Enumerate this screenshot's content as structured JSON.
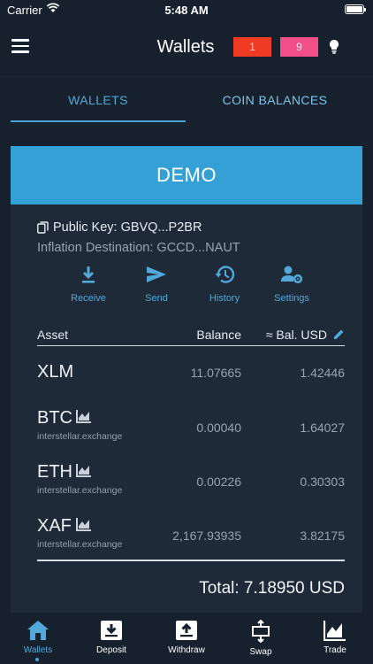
{
  "status_bar": {
    "carrier": "Carrier",
    "time": "5:48 AM"
  },
  "nav": {
    "title": "Wallets",
    "badge_red": "1",
    "badge_pink": "9",
    "colors": {
      "badge_red": "#ef3b24",
      "badge_pink": "#f24f88"
    }
  },
  "tabs": [
    {
      "label": "WALLETS",
      "active": true
    },
    {
      "label": "COIN BALANCES",
      "active": false
    }
  ],
  "wallet": {
    "name": "DEMO",
    "public_key": "Public Key: GBVQ...P2BR",
    "inflation": "Inflation Destination: GCCD...NAUT",
    "actions": [
      {
        "label": "Receive",
        "icon": "download-icon"
      },
      {
        "label": "Send",
        "icon": "send-icon"
      },
      {
        "label": "History",
        "icon": "history-icon"
      },
      {
        "label": "Settings",
        "icon": "user-settings-icon"
      }
    ],
    "table": {
      "headers": {
        "asset": "Asset",
        "balance": "Balance",
        "usd": "≈ Bal. USD"
      },
      "rows": [
        {
          "asset": "XLM",
          "domain": "",
          "balance": "11.07665",
          "usd": "1.42446"
        },
        {
          "asset": "BTC",
          "domain": "interstellar.exchange",
          "balance": "0.00040",
          "usd": "1.64027"
        },
        {
          "asset": "ETH",
          "domain": "interstellar.exchange",
          "balance": "0.00226",
          "usd": "0.30303"
        },
        {
          "asset": "XAF",
          "domain": "interstellar.exchange",
          "balance": "2,167.93935",
          "usd": "3.82175"
        }
      ]
    },
    "total": "Total: 7.18950 USD",
    "accent": "#35a0d6"
  },
  "tabbar": [
    {
      "label": "Wallets",
      "icon": "home-icon",
      "active": true
    },
    {
      "label": "Deposit",
      "icon": "deposit-icon",
      "active": false
    },
    {
      "label": "Withdraw",
      "icon": "withdraw-icon",
      "active": false
    },
    {
      "label": "Swap",
      "icon": "swap-icon",
      "active": false
    },
    {
      "label": "Trade",
      "icon": "trade-chart-icon",
      "active": false
    }
  ]
}
